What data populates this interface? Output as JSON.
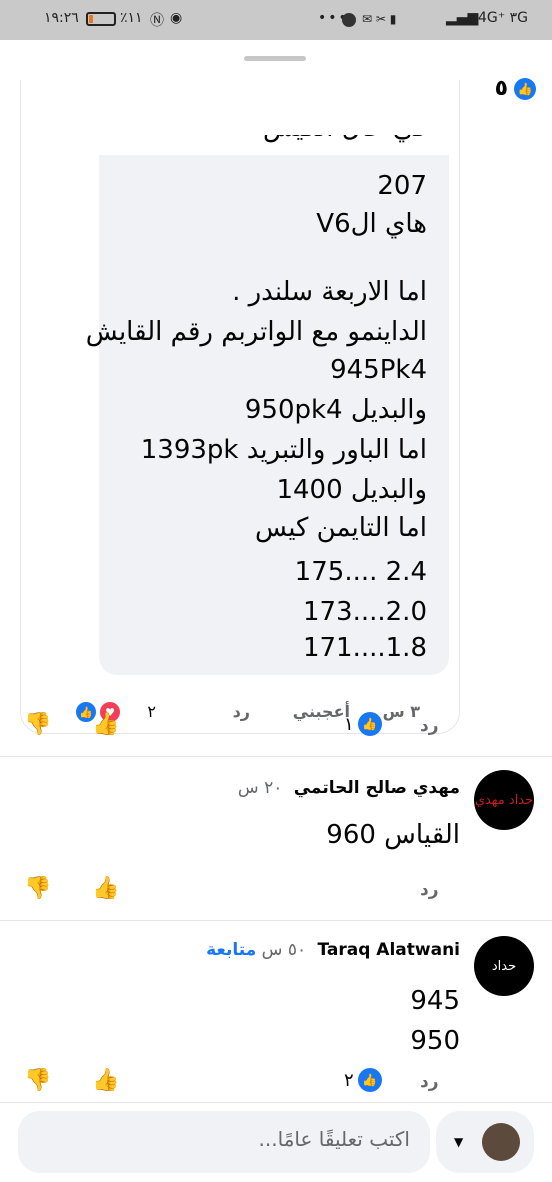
{
  "status_bar": {
    "time": "١٩:٢٦",
    "battery": "٪١١",
    "network": "4G⁺ ۳G",
    "colors": {
      "battery_low": "#e87722"
    }
  },
  "sheet": {
    "top_reactions_count": "٥"
  },
  "reply_comment": {
    "cut_text": "في حال الكيس",
    "lines": [
      "207",
      "هاي الV6",
      "",
      "اما الاربعة سلندر .",
      "الداينمو مع الواتربم رقم القايش",
      "945Pk4",
      "والبديل 950pk4",
      "اما الباور والتبريد 1393pk",
      "والبديل 1400",
      "اما التايمن كيس",
      "2.4 ....175",
      "2.0....173",
      "1.8....171"
    ],
    "time": "٣ س",
    "like_label": "أعجبني",
    "reply_label": "رد",
    "reactions_count": "٢"
  },
  "thread_actions": {
    "reply_label": "رد",
    "likes_count": "١"
  },
  "comments": [
    {
      "name": "مهدي صالح الحاتمي",
      "time": "٢٠ س",
      "follow": "",
      "text_lines": [
        "القياس 960"
      ],
      "avatar_text": "حداد مهدي",
      "reply_label": "رد",
      "likes_count": ""
    },
    {
      "name": "Taraq Alatwani",
      "time": "٥٠ س",
      "follow": "متابعة",
      "text_lines": [
        "945",
        "950"
      ],
      "avatar_text": "حداد",
      "reply_label": "رد",
      "likes_count": "٢"
    }
  ],
  "composer": {
    "placeholder": "اكتب تعليقًا عامًا..."
  },
  "colors": {
    "facebook_blue": "#1877f2",
    "love_red": "#f33e58",
    "bubble_bg": "#f0f2f5"
  }
}
